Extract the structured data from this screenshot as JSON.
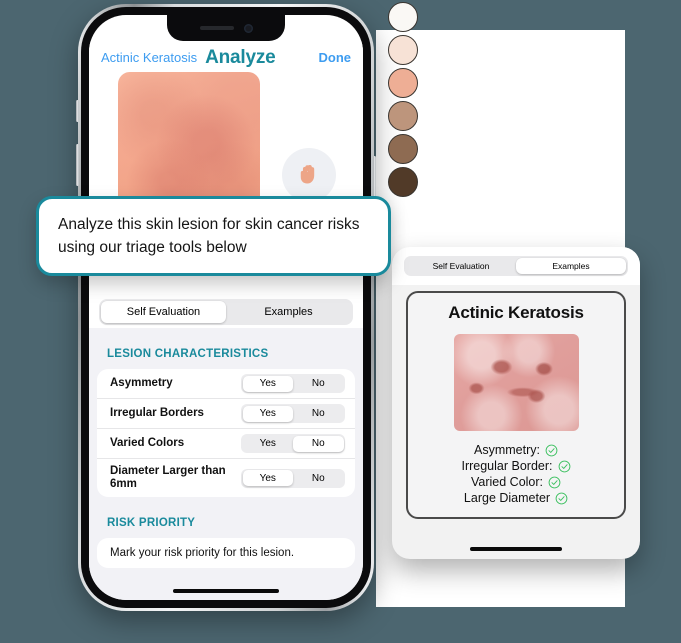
{
  "background_color": "#4c6670",
  "accent_color": "#1a8a9c",
  "link_color": "#3d9cf0",
  "callout": {
    "text": "Analyze this skin lesion for skin cancer risks using our triage tools below",
    "border_color": "#1a8a9c"
  },
  "skin_tone_swatches": [
    {
      "name": "tone-1",
      "color": "#faf8f5"
    },
    {
      "name": "tone-2",
      "color": "#f7e2d6"
    },
    {
      "name": "tone-3",
      "color": "#eeae95"
    },
    {
      "name": "tone-4",
      "color": "#bd957c"
    },
    {
      "name": "tone-5",
      "color": "#8e6b52"
    },
    {
      "name": "tone-6",
      "color": "#513a28"
    }
  ],
  "phone": {
    "nav": {
      "back_label": "Actinic Keratosis",
      "title": "Analyze",
      "done_label": "Done"
    },
    "hand_icon": "raised-hand-icon",
    "tabs": [
      {
        "label": "Self Evaluation",
        "active": true
      },
      {
        "label": "Examples",
        "active": false
      }
    ],
    "lesion_characteristics": {
      "header": "LESION CHARACTERISTICS",
      "yes_label": "Yes",
      "no_label": "No",
      "rows": [
        {
          "label": "Asymmetry",
          "selected": "Yes"
        },
        {
          "label": "Irregular Borders",
          "selected": "Yes"
        },
        {
          "label": "Varied Colors",
          "selected": "No"
        },
        {
          "label": "Diameter Larger than 6mm",
          "selected": "Yes"
        }
      ]
    },
    "risk_priority": {
      "header": "RISK PRIORITY",
      "text": "Mark your risk priority for this lesion."
    }
  },
  "tablet": {
    "tabs": [
      {
        "label": "Self Evaluation",
        "active": false
      },
      {
        "label": "Examples",
        "active": true
      }
    ],
    "example": {
      "title": "Actinic Keratosis",
      "criteria": [
        {
          "label": "Asymmetry:",
          "status": "check"
        },
        {
          "label": "Irregular Border:",
          "status": "check"
        },
        {
          "label": "Varied Color:",
          "status": "check"
        },
        {
          "label": "Large Diameter",
          "status": "check"
        }
      ],
      "check_color": "#3cc060"
    }
  }
}
